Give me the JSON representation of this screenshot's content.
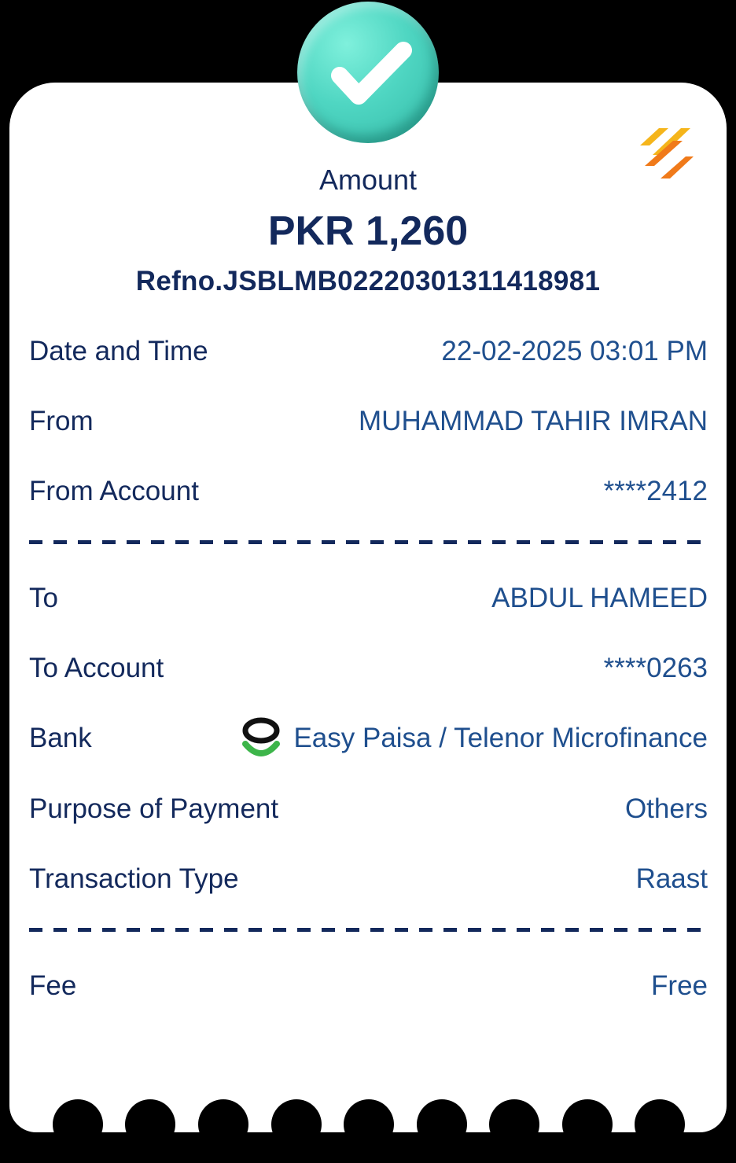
{
  "header": {
    "amount_label": "Amount",
    "amount_value": "PKR 1,260",
    "ref_no": "Ref no. JSBLMB022203013114189 81"
  },
  "details": {
    "date_time": {
      "label": "Date and Time",
      "value": "22-02-2025 03:01 PM"
    },
    "from": {
      "label": "From",
      "value": "MUHAMMAD TAHIR IMRAN"
    },
    "from_account": {
      "label": "From Account",
      "value": "****2412"
    },
    "to": {
      "label": "To",
      "value": "ABDUL HAMEED"
    },
    "to_account": {
      "label": "To Account",
      "value": "****0263"
    },
    "bank": {
      "label": "Bank",
      "value": "Easy Paisa / Telenor Microfinance",
      "icon": "easypaisa-logo-icon"
    },
    "purpose": {
      "label": "Purpose of Payment",
      "value": "Others"
    },
    "transaction_type": {
      "label": "Transaction Type",
      "value": "Raast"
    },
    "fee": {
      "label": "Fee",
      "value": "Free"
    }
  },
  "icons": {
    "status": "success-check-icon",
    "brand": "bank-brand-logo-icon"
  },
  "colors": {
    "primary_text": "#13295c",
    "value_text": "#1f4f8e",
    "success": "#4fd6c2",
    "brand_orange": "#f07a1a",
    "brand_yellow": "#f5b51b",
    "easypaisa_green": "#3db54a"
  }
}
